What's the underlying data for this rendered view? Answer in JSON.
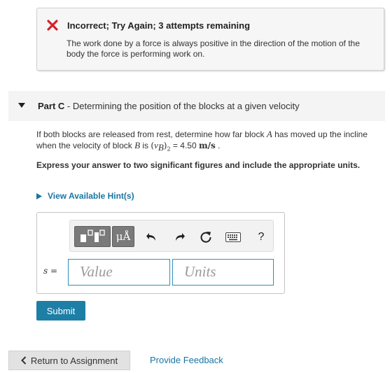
{
  "feedback": {
    "icon": "x-mark-icon",
    "icon_color": "#d2232a",
    "title": "Incorrect; Try Again; 3 attempts remaining",
    "message": "The work done by a force is always positive in the direction of the motion of the body the force is performing work on."
  },
  "part": {
    "label": "Part C",
    "separator": " - ",
    "title": "Determining the position of the blocks at a given velocity"
  },
  "question": {
    "text_1": "If both blocks are released from rest, determine how far block ",
    "block_a": "A",
    "text_2": " has moved up the incline when the velocity of block ",
    "block_b": "B",
    "text_3": " is ",
    "velocity_symbol": "(vB)2",
    "equals": " = ",
    "velocity_value": "4.50",
    "velocity_units": "m/s",
    "end": " .",
    "instructions": "Express your answer to two significant figures and include the appropriate units."
  },
  "hint": {
    "label": "View Available Hint(s)"
  },
  "answer": {
    "toolbar": {
      "templates_icon": "templates-icon",
      "units_label": "μÅ",
      "undo_icon": "undo-icon",
      "redo_icon": "redo-icon",
      "reset_icon": "reset-icon",
      "keyboard_icon": "keyboard-icon",
      "help_label": "?"
    },
    "variable_label": "s =",
    "value_placeholder": "Value",
    "units_placeholder": "Units"
  },
  "buttons": {
    "submit": "Submit",
    "return": "Return to Assignment",
    "feedback": "Provide Feedback"
  },
  "colors": {
    "accent": "#1d7fa6",
    "link": "#1a74a3",
    "error": "#d2232a"
  }
}
